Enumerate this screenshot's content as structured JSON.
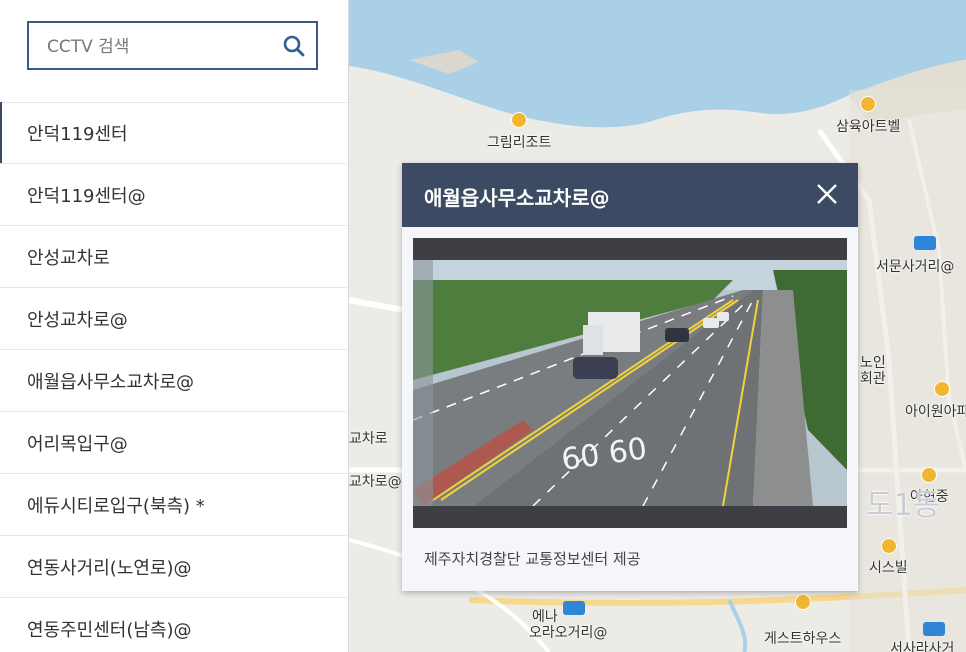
{
  "search": {
    "placeholder": "CCTV 검색"
  },
  "list": {
    "items": [
      "안덕119센터",
      "안덕119센터@",
      "안성교차로",
      "안성교차로@",
      "애월읍사무소교차로@",
      "어리목입구@",
      "에듀시티로입구(북측) *",
      "연동사거리(노연로)@",
      "연동주민센터(남측)@"
    ]
  },
  "map": {
    "labels": {
      "samyook": "삼육아트벨",
      "grim": "그림리조트",
      "seomun": "서문사거리@",
      "chaa": "교차로",
      "chab": "교차로@",
      "aienpi": "아이원아파",
      "ahyeon": "아현중",
      "sisu": "시스빌",
      "oraro": "오라오거리@",
      "guesthouse": "게스트하우스",
      "seosa": "서사라사거",
      "noin": "노인",
      "hoegwan": "회관",
      "enae": "에나",
      "doil": "도1동"
    }
  },
  "popup": {
    "title": "애월읍사무소교차로@",
    "credit": "제주자치경찰단 교통정보센터 제공",
    "road_marking": "60 60"
  },
  "colors": {
    "header": "#3c4a63",
    "search_border": "#3b5a86",
    "sea": "#a9d0e6",
    "cctv_icon": "#2f86d8",
    "poi": "#f2b531"
  },
  "icons": {
    "search": "search-icon",
    "close": "close-icon",
    "cctv": "cctv-camera-icon"
  }
}
